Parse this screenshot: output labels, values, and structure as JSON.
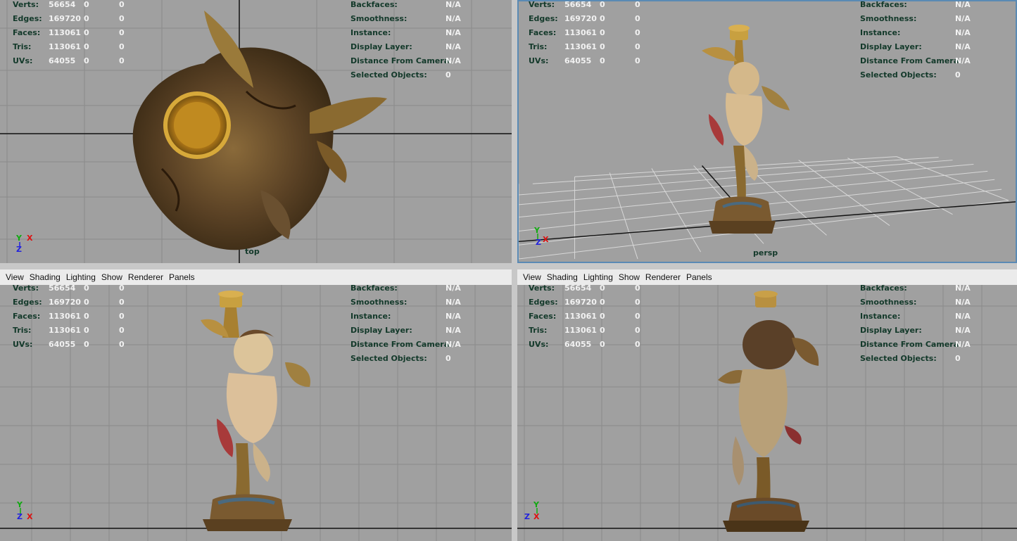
{
  "menu": [
    "View",
    "Shading",
    "Lighting",
    "Show",
    "Renderer",
    "Panels"
  ],
  "hud_stats": [
    {
      "label": "Verts:",
      "v1": "56654",
      "v2": "0",
      "v3": "0"
    },
    {
      "label": "Edges:",
      "v1": "169720",
      "v2": "0",
      "v3": "0"
    },
    {
      "label": "Faces:",
      "v1": "113061",
      "v2": "0",
      "v3": "0"
    },
    {
      "label": "Tris:",
      "v1": "113061",
      "v2": "0",
      "v3": "0"
    },
    {
      "label": "UVs:",
      "v1": "64055",
      "v2": "0",
      "v3": "0"
    }
  ],
  "hud_info": [
    {
      "label": "Backfaces:",
      "value": "N/A"
    },
    {
      "label": "Smoothness:",
      "value": "N/A"
    },
    {
      "label": "Instance:",
      "value": "N/A"
    },
    {
      "label": "Display Layer:",
      "value": "N/A"
    },
    {
      "label": "Distance From Camera:",
      "value": "N/A"
    },
    {
      "label": "Selected Objects:",
      "value": "0"
    }
  ],
  "viewports": {
    "top": {
      "camera": "top"
    },
    "persp": {
      "camera": "persp"
    },
    "front": {
      "camera": ""
    },
    "side": {
      "camera": ""
    }
  },
  "axis_labels": {
    "x": "X",
    "y": "Y",
    "z": "Z"
  },
  "colors": {
    "viewport_bg": "#a0a0a0",
    "grid": "#8a8a8a",
    "hud_label": "#13392a",
    "hud_value": "#f2f2f2",
    "axis_x": "#d11",
    "axis_y": "#1a1",
    "axis_z": "#22d"
  }
}
